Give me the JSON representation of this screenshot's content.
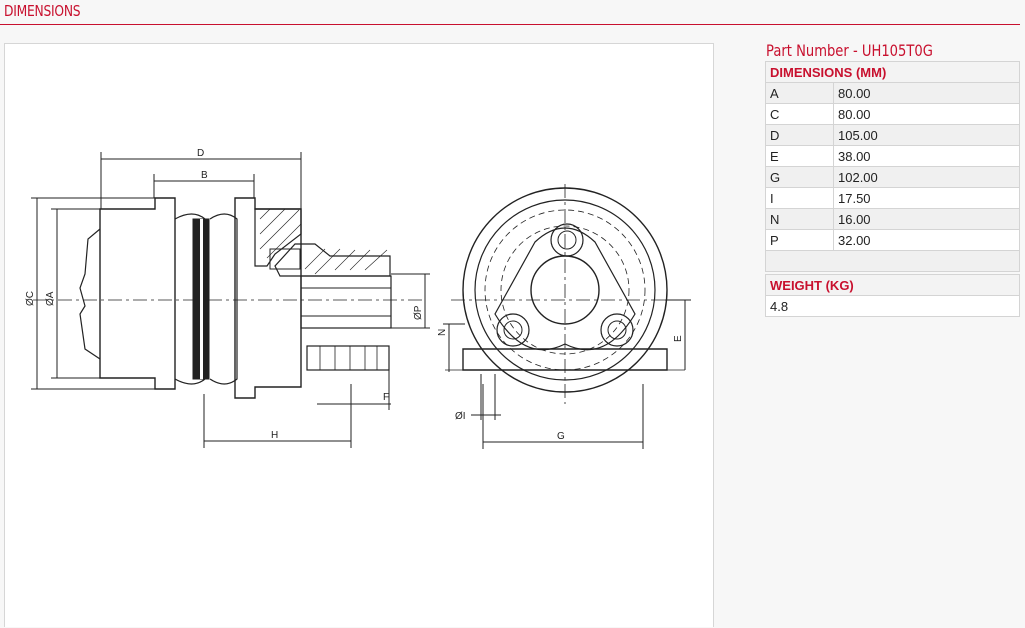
{
  "section": {
    "title": "DIMENSIONS"
  },
  "part": {
    "label": "Part Number - UH105T0G"
  },
  "dimensions": {
    "header": "DIMENSIONS (MM)",
    "rows": [
      {
        "key": "A",
        "value": "80.00"
      },
      {
        "key": "C",
        "value": "80.00"
      },
      {
        "key": "D",
        "value": "105.00"
      },
      {
        "key": "E",
        "value": "38.00"
      },
      {
        "key": "G",
        "value": "102.00"
      },
      {
        "key": "I",
        "value": "17.50"
      },
      {
        "key": "N",
        "value": "16.00"
      },
      {
        "key": "P",
        "value": "32.00"
      }
    ]
  },
  "weight": {
    "header": "WEIGHT (KG)",
    "value": "4.8"
  },
  "drawing_labels": {
    "D": "D",
    "B": "B",
    "C": "ØC",
    "A": "ØA",
    "P": "ØP",
    "F": "F",
    "H": "H",
    "N": "N",
    "E": "E",
    "I": "ØI",
    "G": "G"
  },
  "colors": {
    "accent": "#c8102e"
  }
}
